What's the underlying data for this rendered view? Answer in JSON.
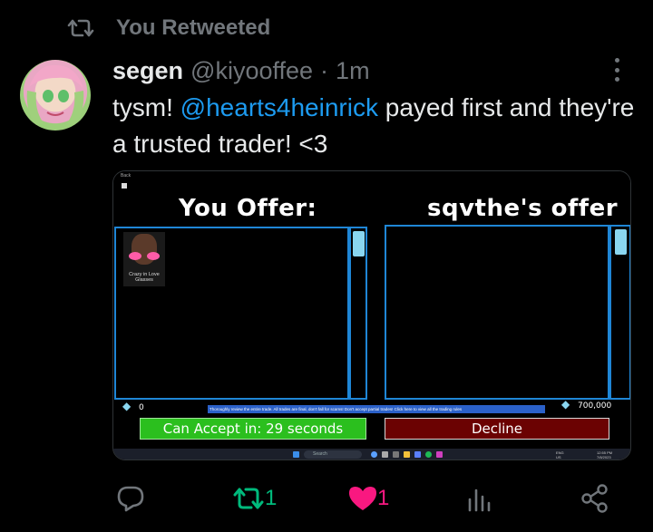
{
  "header": {
    "retweet_label": "You Retweeted"
  },
  "author": {
    "name": "segen",
    "handle": "@kiyooffee",
    "separator": "·",
    "time": "1m"
  },
  "tweet": {
    "text_before": "tysm! ",
    "mention": "@hearts4heinrick",
    "text_after": " payed first and they're a trusted trader! <3"
  },
  "game": {
    "back_label": "Back",
    "you_offer_title": "You Offer:",
    "their_offer_title": "sqvthe's offer",
    "item_name": "Crazy in Love Glasses",
    "your_value": "0",
    "their_value": "700,000",
    "notice": "Thoroughly review the entire trade. All trades are final, don't fall for scams! Don't accept partial trades! Click here to view all the trading rules",
    "accept_label": "Can Accept in: 29 seconds",
    "decline_label": "Decline",
    "taskbar": {
      "search_placeholder": "Search",
      "lang_top": "ENG",
      "lang_bottom": "US",
      "clock_time": "12:55 PM",
      "clock_date": "7/8/2023"
    }
  },
  "actions": {
    "reply_count": "",
    "retweet_count": "1",
    "like_count": "1"
  },
  "colors": {
    "accent": "#1d9bf0",
    "retweet_active": "#00ba7c",
    "like_active": "#f91880",
    "muted": "#71767b"
  }
}
